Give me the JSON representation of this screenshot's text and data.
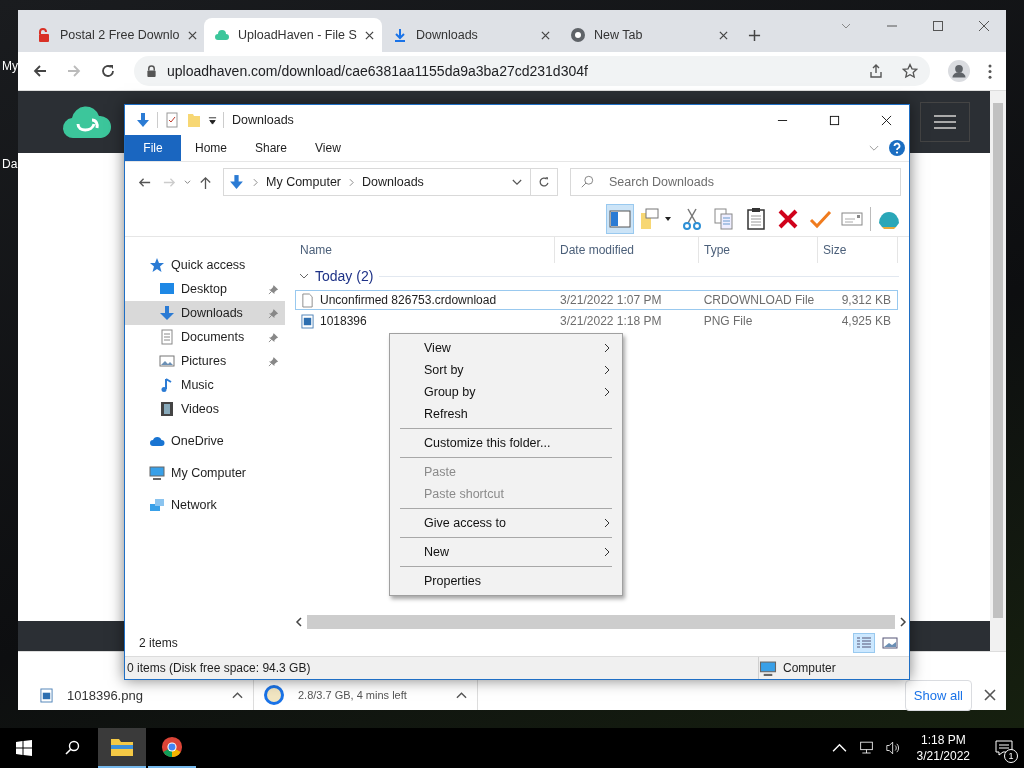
{
  "desktop": {
    "labels": [
      "My",
      "Da"
    ]
  },
  "browser": {
    "tabs": [
      {
        "title": "Postal 2 Free Downlo",
        "kind": "lock",
        "selected": false
      },
      {
        "title": "UploadHaven - File S",
        "kind": "cloud",
        "selected": true
      },
      {
        "title": "Downloads",
        "kind": "download",
        "selected": false
      },
      {
        "title": "New Tab",
        "kind": "globe",
        "selected": false
      }
    ],
    "url": "uploadhaven.com/download/cae6381aa1155da9a3ba27cd231d304f",
    "downloads": [
      {
        "name": "1018396.png",
        "kind": "image"
      },
      {
        "status": "2.8/3.7 GB, 4 mins left",
        "kind": "disc"
      }
    ],
    "show_all": "Show all"
  },
  "explorer": {
    "title": "Downloads",
    "ribbon_tabs": [
      {
        "label": "File",
        "kind": "file"
      },
      {
        "label": "Home",
        "kind": "tab"
      },
      {
        "label": "Share",
        "kind": "tab"
      },
      {
        "label": "View",
        "kind": "tab"
      }
    ],
    "breadcrumbs": [
      "My Computer",
      "Downloads"
    ],
    "search": {
      "placeholder": "Search Downloads"
    },
    "toolbar": [
      {
        "kind": "pane",
        "selected": true
      },
      {
        "kind": "options",
        "selected": false
      },
      {
        "kind": "cut",
        "selected": false
      },
      {
        "kind": "copy",
        "selected": false
      },
      {
        "kind": "paste",
        "selected": false
      },
      {
        "kind": "delete",
        "selected": false
      },
      {
        "kind": "check",
        "selected": false
      },
      {
        "kind": "mail",
        "selected": false
      },
      {
        "kind": "shell",
        "selected": false
      }
    ],
    "nav": [
      {
        "label": "Quick access",
        "kind": "star",
        "selected": false,
        "children": [
          {
            "label": "Desktop",
            "kind": "desktop",
            "pinned": true,
            "selected": false
          },
          {
            "label": "Downloads",
            "kind": "download",
            "pinned": true,
            "selected": true
          },
          {
            "label": "Documents",
            "kind": "document",
            "pinned": true,
            "selected": false
          },
          {
            "label": "Pictures",
            "kind": "pictures",
            "pinned": true,
            "selected": false
          },
          {
            "label": "Music",
            "kind": "music",
            "pinned": false,
            "selected": false
          },
          {
            "label": "Videos",
            "kind": "videos",
            "pinned": false,
            "selected": false
          }
        ]
      },
      {
        "label": "OneDrive",
        "kind": "cloud",
        "selected": false
      },
      {
        "label": "My Computer",
        "kind": "computer",
        "selected": false
      },
      {
        "label": "Network",
        "kind": "network",
        "selected": false
      }
    ],
    "columns": [
      "Name",
      "Date modified",
      "Type",
      "Size"
    ],
    "group": {
      "label": "Today (2)",
      "expanded": true
    },
    "files": [
      {
        "name": "Unconfirmed 826753.crdownload",
        "date": "3/21/2022 1:07 PM",
        "type": "CRDOWNLOAD File",
        "size": "9,312 KB",
        "kind": "blank",
        "focused": true
      },
      {
        "name": "1018396",
        "date": "3/21/2022 1:18 PM",
        "type": "PNG File",
        "size": "4,925 KB",
        "kind": "image",
        "focused": false
      }
    ],
    "item_count": "2 items",
    "views": [
      {
        "kind": "details",
        "selected": true
      },
      {
        "kind": "tiles",
        "selected": false
      }
    ],
    "status": "0 items (Disk free space: 94.3 GB)",
    "status_location": "Computer"
  },
  "context_menu": [
    {
      "kind": "item",
      "label": "View",
      "submenu": true,
      "disabled": false
    },
    {
      "kind": "item",
      "label": "Sort by",
      "submenu": true,
      "disabled": false
    },
    {
      "kind": "item",
      "label": "Group by",
      "submenu": true,
      "disabled": false
    },
    {
      "kind": "item",
      "label": "Refresh",
      "submenu": false,
      "disabled": false
    },
    {
      "kind": "separator"
    },
    {
      "kind": "item",
      "label": "Customize this folder...",
      "submenu": false,
      "disabled": false
    },
    {
      "kind": "separator"
    },
    {
      "kind": "item",
      "label": "Paste",
      "submenu": false,
      "disabled": true
    },
    {
      "kind": "item",
      "label": "Paste shortcut",
      "submenu": false,
      "disabled": true
    },
    {
      "kind": "separator"
    },
    {
      "kind": "item",
      "label": "Give access to",
      "submenu": true,
      "disabled": false
    },
    {
      "kind": "separator"
    },
    {
      "kind": "item",
      "label": "New",
      "submenu": true,
      "disabled": false
    },
    {
      "kind": "separator"
    },
    {
      "kind": "item",
      "label": "Properties",
      "submenu": false,
      "disabled": false
    }
  ],
  "taskbar": {
    "apps": [
      {
        "kind": "folder",
        "active": true
      },
      {
        "kind": "browser",
        "active": false
      }
    ],
    "time": "1:18 PM",
    "date": "3/21/2022",
    "notifications": "1"
  }
}
